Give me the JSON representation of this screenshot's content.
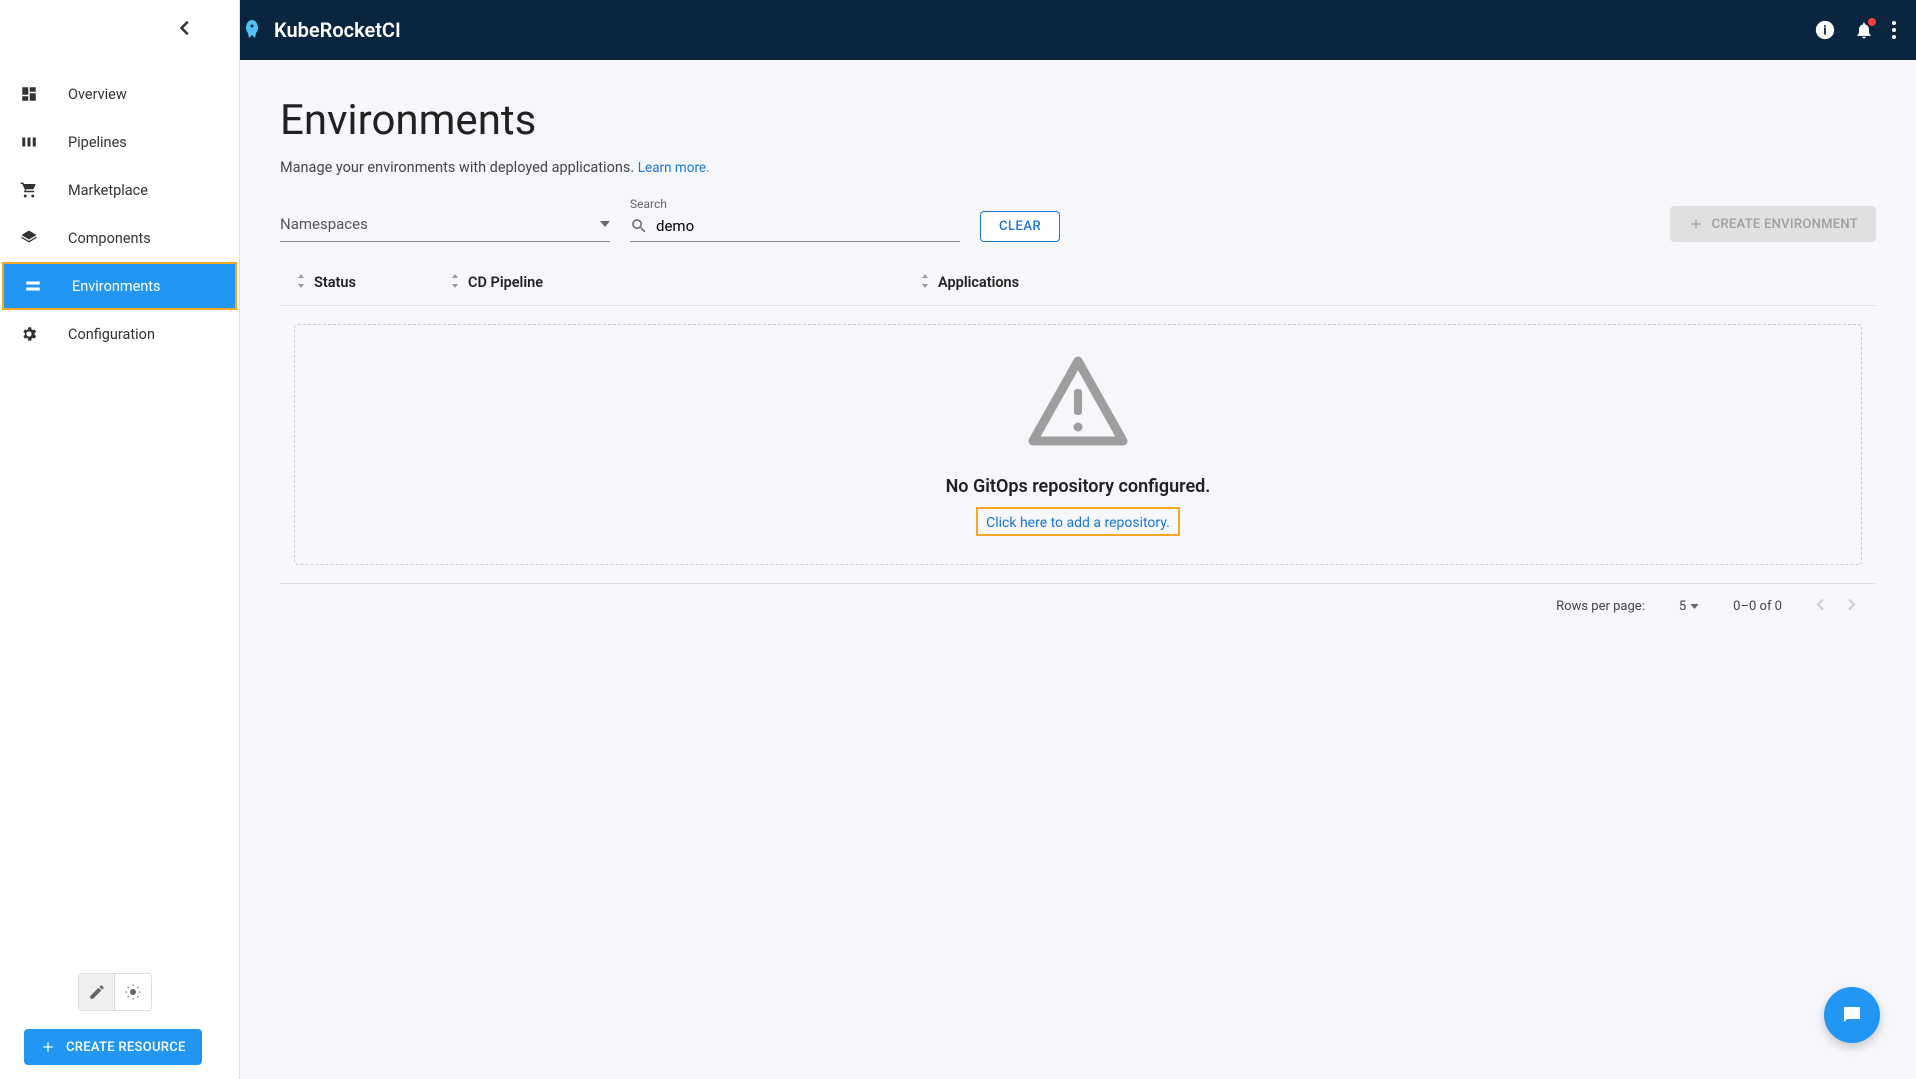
{
  "header": {
    "brand": "KubeRocketCI"
  },
  "sidebar": {
    "items": [
      {
        "label": "Overview"
      },
      {
        "label": "Pipelines"
      },
      {
        "label": "Marketplace"
      },
      {
        "label": "Components"
      },
      {
        "label": "Environments"
      },
      {
        "label": "Configuration"
      }
    ],
    "create_resource": "CREATE RESOURCE"
  },
  "page": {
    "title": "Environments",
    "subtitle": "Manage your environments with deployed applications. ",
    "learn_more": "Learn more."
  },
  "filters": {
    "namespaces_label": "Namespaces",
    "search_label": "Search",
    "search_value": "demo",
    "clear": "CLEAR",
    "create_env": "CREATE ENVIRONMENT"
  },
  "table": {
    "columns": {
      "status": "Status",
      "pipeline": "CD Pipeline",
      "apps": "Applications"
    }
  },
  "empty": {
    "title": "No GitOps repository configured.",
    "link": "Click here to add a repository."
  },
  "pagination": {
    "rows_label": "Rows per page:",
    "rows_value": "5",
    "range": "0–0 of 0"
  }
}
